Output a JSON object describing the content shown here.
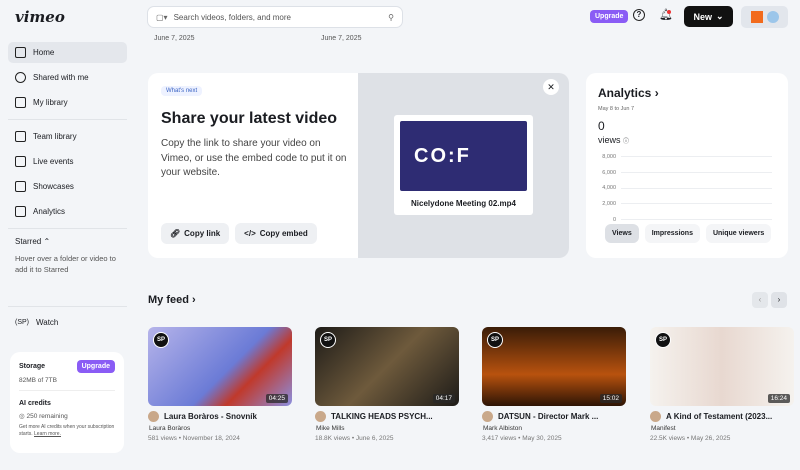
{
  "header": {
    "logo": "vimeo",
    "search_placeholder": "Search videos, folders, and more",
    "upgrade": "Upgrade",
    "new": "New"
  },
  "dates": [
    "June 7, 2025",
    "June 7, 2025"
  ],
  "sidebar": {
    "items": [
      {
        "label": "Home",
        "icon": "home-icon"
      },
      {
        "label": "Shared with me",
        "icon": "users-icon"
      },
      {
        "label": "My library",
        "icon": "library-icon"
      },
      {
        "label": "Team library",
        "icon": "team-library-icon"
      },
      {
        "label": "Live events",
        "icon": "camera-icon"
      },
      {
        "label": "Showcases",
        "icon": "showcase-icon"
      },
      {
        "label": "Analytics",
        "icon": "analytics-icon"
      }
    ],
    "starred": "Starred",
    "starred_hint": "Hover over a folder or video to add it to Starred",
    "watch": "Watch"
  },
  "storage": {
    "title": "Storage",
    "upgrade": "Upgrade",
    "usage": "82MB of 7TB",
    "ai_title": "AI credits",
    "ai_remaining": "250 remaining",
    "ai_note": "Get more AI credits when your subscription starts.",
    "learn_more": "Learn more."
  },
  "hero": {
    "pill": "What's next",
    "title": "Share your latest video",
    "desc": "Copy the link to share your video on Vimeo, or use the embed code to put it on your website.",
    "copy_link": "Copy link",
    "copy_embed": "Copy embed",
    "video_title": "Nicelydone Meeting 02.mp4",
    "thumb_text": "CO:F"
  },
  "analytics": {
    "title": "Analytics",
    "range": "May 8 to Jun 7",
    "count": "0",
    "unit": "views",
    "ticks": [
      "8,000",
      "6,000",
      "4,000",
      "2,000",
      "0"
    ],
    "tabs": [
      "Views",
      "Impressions",
      "Unique viewers"
    ],
    "active_tab": "Views"
  },
  "feed": {
    "title": "My feed",
    "videos": [
      {
        "title": "Laura Boràros - Snovník",
        "author": "Laura Boràros",
        "meta": "581 views • November 18, 2024",
        "duration": "04:25"
      },
      {
        "title": "TALKING HEADS PSYCH...",
        "author": "Mike Mills",
        "meta": "18.8K views • June 6, 2025",
        "duration": "04:17"
      },
      {
        "title": "DATSUN - Director Mark ...",
        "author": "Mark Albiston",
        "meta": "3,417 views • May 30, 2025",
        "duration": "15:02"
      },
      {
        "title": "A Kind of Testament (2023...",
        "author": "Manifest",
        "meta": "22.5K views • May 26, 2025",
        "duration": "16:24"
      }
    ]
  },
  "badge": "SP"
}
